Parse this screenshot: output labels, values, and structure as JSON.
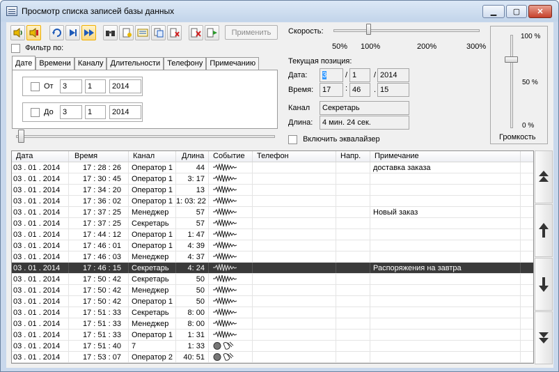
{
  "window": {
    "title": "Просмотр списка записей базы данных"
  },
  "toolbar": {
    "apply_label": "Применить",
    "icons": [
      "play-left-icon",
      "record-mic-icon",
      "refresh-icon",
      "skip-end-icon",
      "fast-forward-icon",
      "binoculars-icon",
      "new-doc-icon",
      "list-icon",
      "copy-doc-icon",
      "delete-doc-icon",
      "delete-red-icon",
      "export-green-icon"
    ]
  },
  "filter": {
    "label": "Фильтр по:",
    "checked": false
  },
  "tabs": [
    "Дате",
    "Времени",
    "Каналу",
    "Длительности",
    "Телефону",
    "Примечанию"
  ],
  "date_filter": {
    "from": {
      "label": "От",
      "day": "3",
      "month": "1",
      "year": "2014"
    },
    "to": {
      "label": "До",
      "day": "3",
      "month": "1",
      "year": "2014"
    }
  },
  "speed": {
    "label": "Скорость:",
    "ticks": [
      "50%",
      "100%",
      "200%",
      "300%"
    ]
  },
  "position": {
    "label": "Текущая позиция:",
    "date_label": "Дата:",
    "day": "3",
    "month": "1",
    "year": "2014",
    "time_label": "Время:",
    "hour": "17",
    "minute": "46",
    "second": "15"
  },
  "channel": {
    "label": "Канал",
    "value": "Секретарь"
  },
  "length": {
    "label": "Длина:",
    "value": "4 мин. 24 сек."
  },
  "equalizer": {
    "label": "Включить эквалайзер",
    "checked": false
  },
  "volume": {
    "label": "Громкость",
    "ticks": [
      "100 %",
      "50 %",
      "0 %"
    ],
    "level": 0.75
  },
  "table": {
    "columns": [
      "Дата",
      "Время",
      "Канал",
      "Длина",
      "Событие",
      "Телефон",
      "Напр.",
      "Примечание"
    ],
    "rows": [
      {
        "date": "03 . 01 . 2014",
        "time": "17 : 28 : 26",
        "channel": "Оператор 1",
        "length": "44",
        "event": "wave",
        "note": "доставка заказа"
      },
      {
        "date": "03 . 01 . 2014",
        "time": "17 : 30 : 45",
        "channel": "Оператор 1",
        "length": "3: 17",
        "event": "wave",
        "note": ""
      },
      {
        "date": "03 . 01 . 2014",
        "time": "17 : 34 : 20",
        "channel": "Оператор 1",
        "length": "13",
        "event": "wave",
        "note": ""
      },
      {
        "date": "03 . 01 . 2014",
        "time": "17 : 36 : 02",
        "channel": "Оператор 1",
        "length": "1: 03: 22",
        "event": "wave",
        "note": ""
      },
      {
        "date": "03 . 01 . 2014",
        "time": "17 : 37 : 25",
        "channel": "Менеджер",
        "length": "57",
        "event": "wave",
        "note": "Новый заказ"
      },
      {
        "date": "03 . 01 . 2014",
        "time": "17 : 37 : 25",
        "channel": "Секретарь",
        "length": "57",
        "event": "wave",
        "note": ""
      },
      {
        "date": "03 . 01 . 2014",
        "time": "17 : 44 : 12",
        "channel": "Оператор 1",
        "length": "1: 47",
        "event": "wave",
        "note": ""
      },
      {
        "date": "03 . 01 . 2014",
        "time": "17 : 46 : 01",
        "channel": "Оператор 1",
        "length": "4: 39",
        "event": "wave",
        "note": ""
      },
      {
        "date": "03 . 01 . 2014",
        "time": "17 : 46 : 03",
        "channel": "Менеджер",
        "length": "4: 37",
        "event": "wave",
        "note": ""
      },
      {
        "date": "03 . 01 . 2014",
        "time": "17 : 46 : 15",
        "channel": "Секретарь",
        "length": "4: 24",
        "event": "wave",
        "note": "Распоряжения на завтра",
        "selected": true
      },
      {
        "date": "03 . 01 . 2014",
        "time": "17 : 50 : 42",
        "channel": "Секретарь",
        "length": "50",
        "event": "wave",
        "note": ""
      },
      {
        "date": "03 . 01 . 2014",
        "time": "17 : 50 : 42",
        "channel": "Менеджер",
        "length": "50",
        "event": "wave",
        "note": ""
      },
      {
        "date": "03 . 01 . 2014",
        "time": "17 : 50 : 42",
        "channel": "Оператор 1",
        "length": "50",
        "event": "wave",
        "note": ""
      },
      {
        "date": "03 . 01 . 2014",
        "time": "17 : 51 : 33",
        "channel": "Секретарь",
        "length": "8: 00",
        "event": "wave",
        "note": ""
      },
      {
        "date": "03 . 01 . 2014",
        "time": "17 : 51 : 33",
        "channel": "Менеджер",
        "length": "8: 00",
        "event": "wave",
        "note": ""
      },
      {
        "date": "03 . 01 . 2014",
        "time": "17 : 51 : 33",
        "channel": "Оператор 1",
        "length": "1: 31",
        "event": "wave",
        "note": ""
      },
      {
        "date": "03 . 01 . 2014",
        "time": "17 : 51 : 40",
        "channel": "7",
        "length": "1: 33",
        "event": "phone",
        "note": ""
      },
      {
        "date": "03 . 01 . 2014",
        "time": "17 : 53 : 07",
        "channel": "Оператор 2",
        "length": "40: 51",
        "event": "phone",
        "note": ""
      }
    ]
  },
  "nav_buttons": [
    "first-page-icon",
    "page-up-icon",
    "page-down-icon",
    "last-page-icon"
  ]
}
